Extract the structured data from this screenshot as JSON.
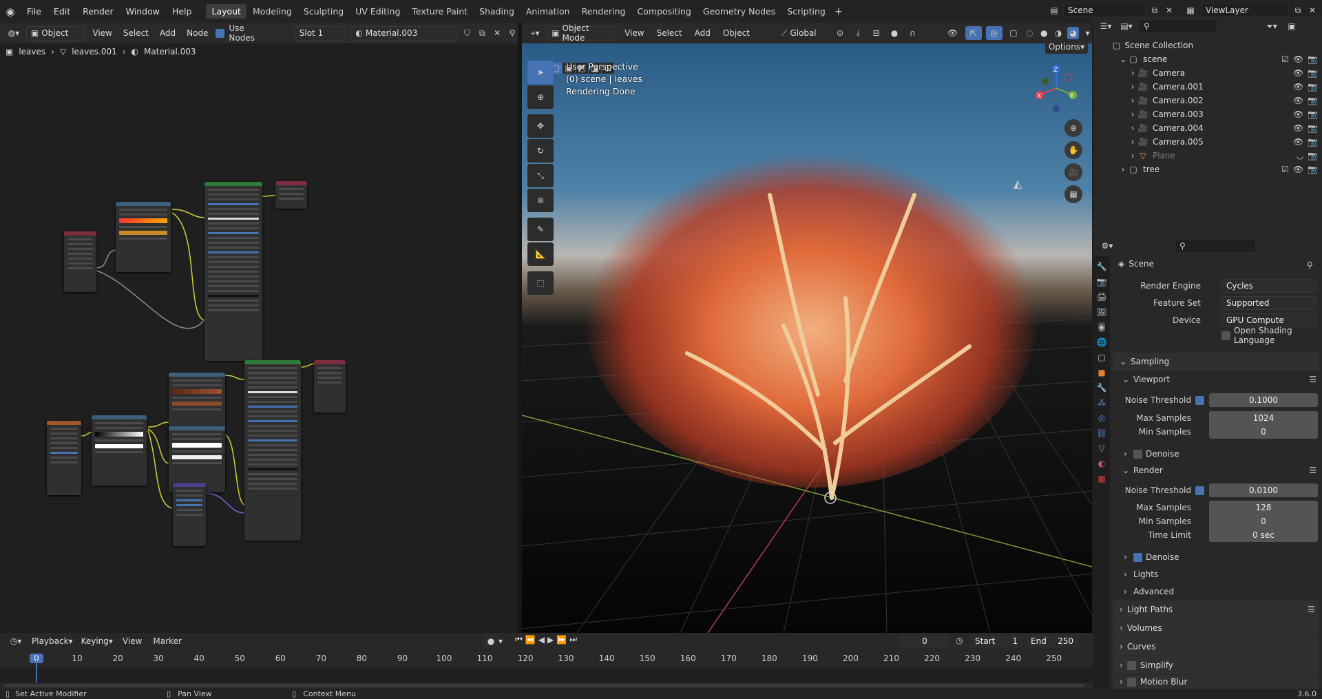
{
  "app": {
    "version": "3.6.0"
  },
  "topbar": {
    "menus": [
      "File",
      "Edit",
      "Render",
      "Window",
      "Help"
    ],
    "workspaces": [
      "Layout",
      "Modeling",
      "Sculpting",
      "UV Editing",
      "Texture Paint",
      "Shading",
      "Animation",
      "Rendering",
      "Compositing",
      "Geometry Nodes",
      "Scripting"
    ],
    "active_workspace": "Layout",
    "scene_name": "Scene",
    "viewlayer_name": "ViewLayer"
  },
  "node_editor": {
    "mode": "Object",
    "menus": [
      "View",
      "Select",
      "Add",
      "Node"
    ],
    "use_nodes_label": "Use Nodes",
    "slot": "Slot 1",
    "material": "Material.003",
    "breadcrumb": [
      "leaves",
      "leaves.001",
      "Material.003"
    ]
  },
  "viewport": {
    "mode": "Object Mode",
    "menus": [
      "View",
      "Select",
      "Add",
      "Object"
    ],
    "orientation": "Global",
    "options_label": "Options",
    "info_lines": [
      "User Perspective",
      "(0) scene | leaves",
      "Rendering Done"
    ],
    "gizmo_axes": [
      "X",
      "Y",
      "Z"
    ]
  },
  "outliner": {
    "root": "Scene Collection",
    "items": [
      {
        "name": "scene",
        "depth": 0,
        "kind": "collection"
      },
      {
        "name": "Camera",
        "depth": 1,
        "kind": "camera"
      },
      {
        "name": "Camera.001",
        "depth": 1,
        "kind": "camera"
      },
      {
        "name": "Camera.002",
        "depth": 1,
        "kind": "camera"
      },
      {
        "name": "Camera.003",
        "depth": 1,
        "kind": "camera"
      },
      {
        "name": "Camera.004",
        "depth": 1,
        "kind": "camera"
      },
      {
        "name": "Camera.005",
        "depth": 1,
        "kind": "camera"
      },
      {
        "name": "Plane",
        "depth": 1,
        "kind": "mesh"
      },
      {
        "name": "tree",
        "depth": 0,
        "kind": "collection"
      }
    ]
  },
  "properties": {
    "context": "Scene",
    "render_engine_label": "Render Engine",
    "render_engine": "Cycles",
    "feature_set_label": "Feature Set",
    "feature_set": "Supported",
    "device_label": "Device",
    "device": "GPU Compute",
    "osl_label": "Open Shading Language",
    "sampling": "Sampling",
    "viewport_panel": "Viewport",
    "noise_threshold_label": "Noise Threshold",
    "viewport_noise": "0.1000",
    "max_samples_label": "Max Samples",
    "viewport_max": "1024",
    "min_samples_label": "Min Samples",
    "viewport_min": "0",
    "denoise_label": "Denoise",
    "render_panel": "Render",
    "render_noise": "0.0100",
    "render_max": "128",
    "render_min": "0",
    "time_limit_label": "Time Limit",
    "time_limit": "0 sec",
    "lights": "Lights",
    "advanced": "Advanced",
    "light_paths": "Light Paths",
    "volumes": "Volumes",
    "curves": "Curves",
    "simplify": "Simplify",
    "motion_blur": "Motion Blur"
  },
  "timeline": {
    "menus": [
      "Playback",
      "Keying",
      "View",
      "Marker"
    ],
    "current_frame": "0",
    "start_label": "Start",
    "start": "1",
    "end_label": "End",
    "end": "250",
    "ticks": [
      "0",
      "10",
      "20",
      "30",
      "40",
      "50",
      "60",
      "70",
      "80",
      "90",
      "100",
      "110",
      "120",
      "130",
      "140",
      "150",
      "160",
      "170",
      "180",
      "190",
      "200",
      "210",
      "220",
      "230",
      "240",
      "250"
    ]
  },
  "status": {
    "left": "Set Active Modifier",
    "middle": "Pan View",
    "right": "Context Menu"
  },
  "colors": {
    "accent": "#4772b3",
    "node_green": "#2d7a3a",
    "node_blue": "#3c5f7d",
    "node_red": "#7d2d3f"
  }
}
